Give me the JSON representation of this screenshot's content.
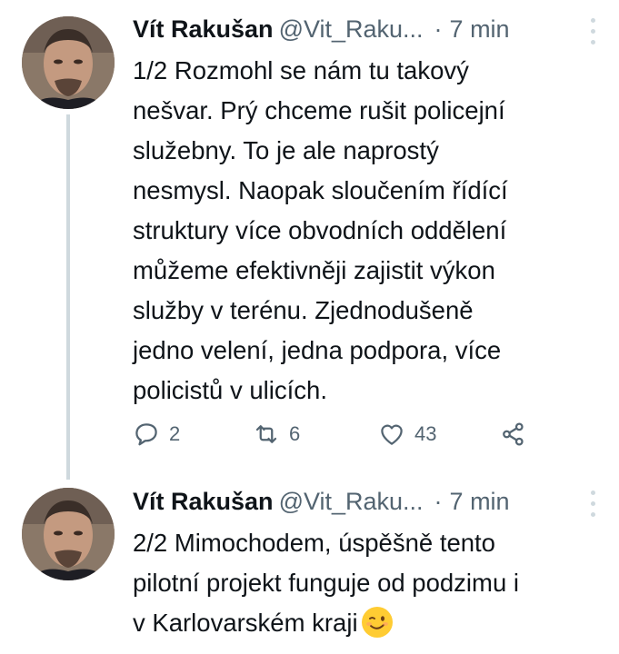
{
  "tweets": [
    {
      "author_name": "Vít Rakušan",
      "handle": "@Vit_Raku...",
      "separator": "·",
      "time": "7 min",
      "lines": [
        "1/2 Rozmohl se nám tu takový",
        "nešvar. Prý chceme rušit policejní",
        "služebny. To je ale naprostý",
        "nesmysl. Naopak sloučením řídící",
        "struktury více obvodních oddělení",
        "můžeme efektivněji zajistit výkon",
        "služby v terénu. Zjednodušeně",
        "jedno velení, jedna podpora, více",
        "policistů v ulicích."
      ],
      "replies": "2",
      "retweets": "6",
      "likes": "43"
    },
    {
      "author_name": "Vít Rakušan",
      "handle": "@Vit_Raku...",
      "separator": "·",
      "time": "7 min",
      "lines": [
        "2/2 Mimochodem, úspěšně tento",
        "pilotní projekt funguje od podzimu i",
        "v Karlovarském kraji"
      ],
      "emoji": "winking-face"
    }
  ],
  "colors": {
    "text": "#0f1419",
    "secondary": "#536471",
    "thread_line": "#cfd9de",
    "emoji": "#ffcc33"
  },
  "icons": [
    "reply-icon",
    "retweet-icon",
    "like-icon",
    "share-icon",
    "more-icon",
    "winking-face-emoji"
  ]
}
